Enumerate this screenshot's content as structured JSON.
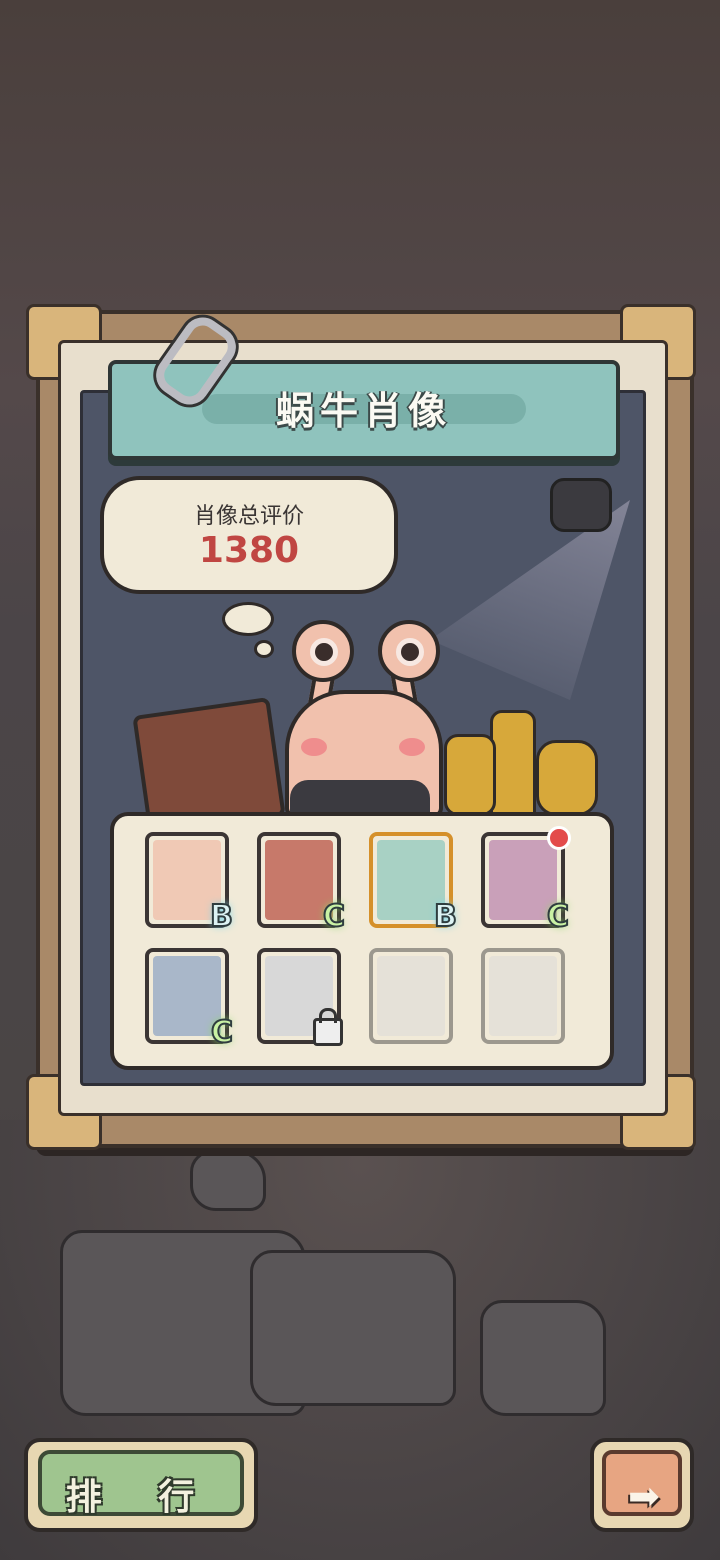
{
  "title": "蜗牛肖像",
  "rating": {
    "label": "肖像总评价",
    "value": "1380"
  },
  "cards": [
    {
      "name": "snail-portrait-card",
      "grade": "B",
      "color": "#f0c9b5",
      "badge": false,
      "locked": false,
      "selected": false
    },
    {
      "name": "wolf-card",
      "grade": "C",
      "color": "#c7796a",
      "badge": false,
      "locked": false,
      "selected": false
    },
    {
      "name": "sunglasses-guy-card",
      "grade": "B",
      "color": "#a8d1c4",
      "badge": false,
      "locked": false,
      "selected": true
    },
    {
      "name": "bearded-warrior-card",
      "grade": "C",
      "color": "#c9a0b9",
      "badge": true,
      "locked": false,
      "selected": false
    },
    {
      "name": "machine-card",
      "grade": "C",
      "color": "#a9b7c9",
      "badge": false,
      "locked": false,
      "selected": false
    },
    {
      "name": "cloud-creature-card",
      "grade": "",
      "color": "#d8d8d8",
      "badge": false,
      "locked": true,
      "selected": false
    },
    {
      "name": "mystery-card-1",
      "grade": "",
      "color": "#d8d8d8",
      "badge": false,
      "locked": false,
      "hidden": true,
      "selected": false
    },
    {
      "name": "mystery-card-2",
      "grade": "",
      "color": "#d8d8d8",
      "badge": false,
      "locked": false,
      "hidden": true,
      "selected": false
    }
  ],
  "buttons": {
    "rank": "排 行",
    "next_icon": "arrow-right-icon"
  }
}
